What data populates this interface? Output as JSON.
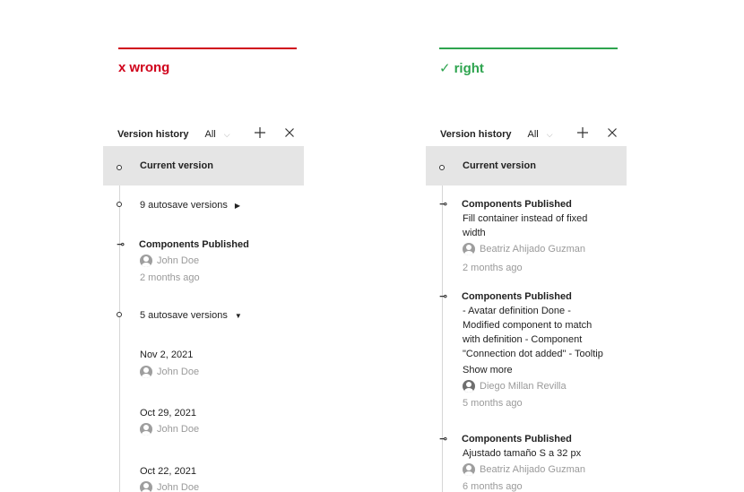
{
  "wrong": {
    "label": "wrong",
    "glyph": "x",
    "color": "#d0021b",
    "panel": {
      "title": "Version history",
      "filter": "All",
      "current": "Current version",
      "autosave_1": "9 autosave versions",
      "pub_title": "Components Published",
      "pub_user": "John Doe",
      "pub_time": "2 months ago",
      "autosave_2": "5 autosave versions",
      "versions": [
        {
          "date": "Nov 2, 2021",
          "user": "John Doe"
        },
        {
          "date": "Oct 29, 2021",
          "user": "John Doe"
        },
        {
          "date": "Oct 22, 2021",
          "user": "John Doe"
        }
      ]
    }
  },
  "right": {
    "label": "right",
    "glyph": "✓",
    "color": "#2ea44f",
    "panel": {
      "title": "Version history",
      "filter": "All",
      "current": "Current version",
      "items": [
        {
          "title": "Components Published",
          "desc_lines": [
            "Fill container instead of fixed",
            "width"
          ],
          "user": "Beatriz Ahijado Guzman",
          "time": "2 months ago"
        },
        {
          "title": "Components Published",
          "desc_lines": [
            "- Avatar definition Done -",
            "Modified component to match",
            "with definition - Component",
            "\"Connection dot added\" - Tooltip"
          ],
          "show_more": "Show more",
          "user": "Diego Millan Revilla",
          "time": "5 months ago"
        },
        {
          "title": "Components Published",
          "desc_lines": [
            "Ajustado tamaño S a 32 px"
          ],
          "user": "Beatriz Ahijado Guzman",
          "time": "6 months ago"
        }
      ]
    }
  },
  "icons": {
    "filter_chevron": "chevron-down-icon",
    "add": "plus-icon",
    "close": "close-icon",
    "published_node": "arrow-node-icon",
    "expand_right": "triangle-right-icon",
    "expand_down": "triangle-down-icon",
    "avatar": "user-avatar-icon"
  }
}
